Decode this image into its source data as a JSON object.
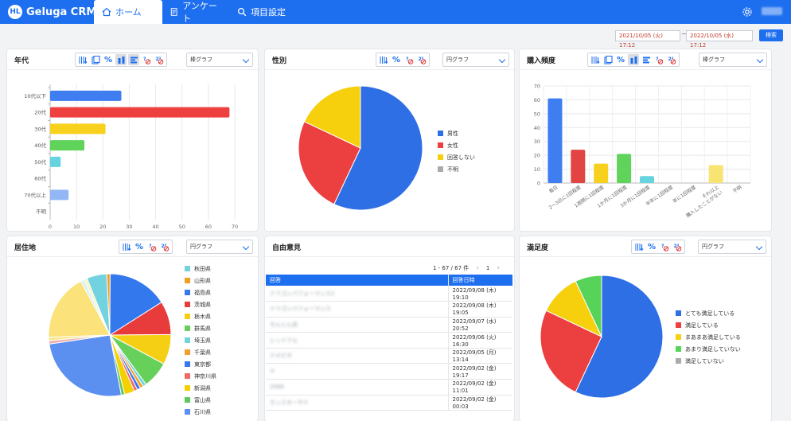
{
  "app": {
    "logo_mark": "HL",
    "logo_text": "Geluga CRM",
    "tabs": [
      {
        "label": "ホーム",
        "icon": "home-icon"
      },
      {
        "label": "アンケート",
        "icon": "survey-icon"
      },
      {
        "label": "項目設定",
        "icon": "search-icon"
      }
    ],
    "user_label": "████",
    "accent": "#1e6ff0"
  },
  "filter": {
    "date_from": "2021/10/05 (火) 17:12",
    "date_to": "2022/10/05 (水) 17:12",
    "separator": "~",
    "search_label": "検索"
  },
  "cards": {
    "age": {
      "title": "年代",
      "chart_type": "棒グラフ"
    },
    "gender": {
      "title": "性別",
      "chart_type": "円グラフ"
    },
    "frequency": {
      "title": "購入頻度",
      "chart_type": "棒グラフ"
    },
    "residence": {
      "title": "居住地",
      "chart_type": "円グラフ"
    },
    "feedback": {
      "title": "自由意見"
    },
    "satisfaction": {
      "title": "満足度",
      "chart_type": "円グラフ"
    }
  },
  "feedback": {
    "pager_text": "1 - 67 / 67 件",
    "page": "1",
    "columns": [
      "回答",
      "回答日時"
    ],
    "rows": [
      {
        "answer": "ドラゴンパフォーマンス2",
        "date": "2022/09/08 (木) 19:10"
      },
      {
        "answer": "ドラゴンパフォーマンス",
        "date": "2022/09/08 (木) 19:05"
      },
      {
        "answer": "ちんとん良",
        "date": "2022/09/07 (水) 20:52"
      },
      {
        "answer": "レッドアル",
        "date": "2022/09/06 (火) 16:30"
      },
      {
        "answer": "テオピネ",
        "date": "2022/09/05 (月) 13:14"
      },
      {
        "answer": "ヤ",
        "date": "2022/09/02 (金) 19:17"
      },
      {
        "answer": "2066",
        "date": "2022/09/02 (金) 11:01"
      },
      {
        "answer": "モンスターサテ",
        "date": "2022/09/02 (金) 00:03"
      }
    ]
  },
  "chart_data": [
    {
      "type": "bar",
      "orientation": "horizontal",
      "categories": [
        "10代以下",
        "20代",
        "30代",
        "40代",
        "50代",
        "60代",
        "70代以上",
        "不明"
      ],
      "values": [
        27,
        68,
        21,
        13,
        4,
        0,
        7,
        0
      ],
      "colors": [
        "#3e7ef0",
        "#ef4040",
        "#f7d11e",
        "#5fd35a",
        "#66d3e0",
        "#d55fd8",
        "#93b7f5",
        "#aaaaaa"
      ],
      "xlim": [
        0,
        70
      ],
      "xticks": [
        "0",
        "10",
        "20",
        "30",
        "40",
        "50",
        "60",
        "70"
      ],
      "grid": true
    },
    {
      "type": "pie",
      "categories": [
        "男性",
        "女性",
        "回答しない",
        "不明"
      ],
      "values": [
        57,
        25,
        18,
        0
      ],
      "colors": [
        "#2f6fe6",
        "#ec3f3f",
        "#f6cf0d",
        "#aaaaaa"
      ],
      "legend": "right"
    },
    {
      "type": "bar",
      "orientation": "vertical",
      "categories": [
        "毎日",
        "2〜3日に1回程度",
        "1週間に1回程度",
        "1か月に1回程度",
        "3か月に1回程度",
        "半年に1回程度",
        "年に1回程度",
        "それ以上\n購入したことがない",
        "不明"
      ],
      "values": [
        61,
        24,
        14,
        21,
        5,
        0,
        0,
        13,
        0
      ],
      "colors": [
        "#3e7ef0",
        "#e24444",
        "#f7d11e",
        "#5fd35a",
        "#66d3e0",
        "#d55fd8",
        "#93b7f5",
        "#f7e473",
        "#aaaaaa"
      ],
      "ylim": [
        0,
        70
      ],
      "yticks": [
        "0",
        "10",
        "20",
        "30",
        "40",
        "50",
        "60",
        "70"
      ],
      "grid": true
    },
    {
      "type": "pie",
      "categories": [
        "秋田県",
        "山形県",
        "福島県",
        "茨城県",
        "栃木県",
        "群馬県",
        "埼玉県",
        "千葉県",
        "東京都",
        "神奈川県",
        "新潟県",
        "富山県",
        "石川県"
      ],
      "values": [
        6,
        1,
        18,
        10,
        9,
        8,
        1,
        1,
        1,
        1,
        3,
        1,
        29,
        1,
        1,
        20,
        1,
        1
      ],
      "colors": [
        "#72d2df",
        "#f0a020",
        "#3478ee",
        "#e83b3b",
        "#f5cf14",
        "#67d05b",
        "#6fd4dd",
        "#f0a030",
        "#3878ee",
        "#ef6a6a",
        "#f5d000",
        "#5ec85a",
        "#5b8ff0",
        "#f0b0b0",
        "#f8e888",
        "#fbe27a",
        "#d8f0f3",
        "#f5f5c0"
      ],
      "legend": "right"
    },
    {
      "type": "pie",
      "categories": [
        "とても満足している",
        "満足している",
        "まあまあ満足している",
        "あまり満足していない",
        "満足していない"
      ],
      "values": [
        57,
        25,
        11,
        7,
        0
      ],
      "colors": [
        "#2f6fe6",
        "#ec3f3f",
        "#f6cf0d",
        "#58d35a",
        "#aaaaaa"
      ],
      "legend": "right"
    }
  ]
}
